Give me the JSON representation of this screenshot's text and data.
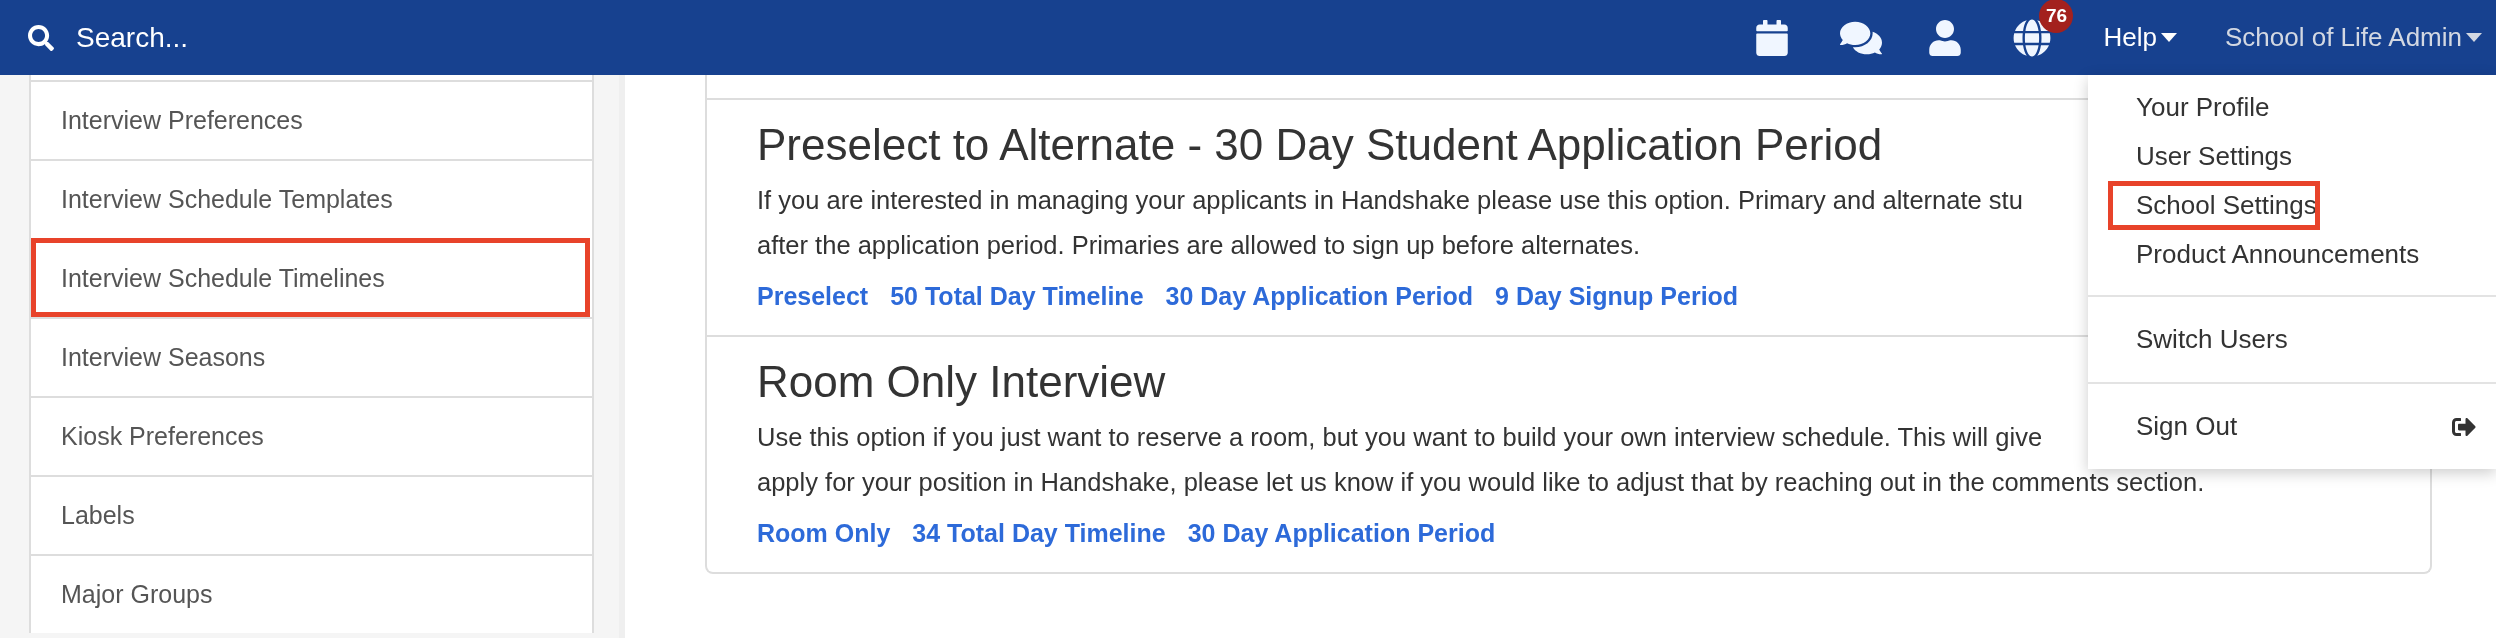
{
  "navbar": {
    "search": {
      "placeholder": "Search..."
    },
    "notifications_badge": "76",
    "help": "Help",
    "account": "School of Life Admin"
  },
  "sidebar": {
    "items": [
      {
        "label": "Interview Preferences",
        "highlighted": false
      },
      {
        "label": "Interview Schedule Templates",
        "highlighted": false
      },
      {
        "label": "Interview Schedule Timelines",
        "highlighted": true
      },
      {
        "label": "Interview Seasons",
        "highlighted": false
      },
      {
        "label": "Kiosk Preferences",
        "highlighted": false
      },
      {
        "label": "Labels",
        "highlighted": false
      },
      {
        "label": "Major Groups",
        "highlighted": false
      }
    ]
  },
  "sections": [
    {
      "title": "Preselect to Alternate - 30 Day Student Application Period",
      "description_lines": [
        "If you are interested in managing your applicants in Handshake please use this option. Primary and alternate stu",
        "after the application period. Primaries are allowed to sign up before alternates."
      ],
      "tags": [
        "Preselect",
        "50 Total Day Timeline",
        "30 Day Application Period",
        "9 Day Signup Period"
      ]
    },
    {
      "title": "Room Only Interview",
      "description_lines": [
        "Use this option if you just want to reserve a room, but you want to build your own interview schedule. This will give",
        "apply for your position in Handshake, please let us know if you would like to adjust that by reaching out in the comments section."
      ],
      "tags": [
        "Room Only",
        "34 Total Day Timeline",
        "30 Day Application Period"
      ]
    }
  ],
  "account_menu": {
    "groups": [
      [
        {
          "label": "Your Profile",
          "highlighted": false
        },
        {
          "label": "User Settings",
          "highlighted": false
        },
        {
          "label": "School Settings",
          "highlighted": true
        },
        {
          "label": "Product Announcements",
          "highlighted": false
        }
      ],
      [
        {
          "label": "Switch Users",
          "highlighted": false
        }
      ],
      [
        {
          "label": "Sign Out",
          "highlighted": false,
          "kind": "signout"
        }
      ]
    ]
  }
}
